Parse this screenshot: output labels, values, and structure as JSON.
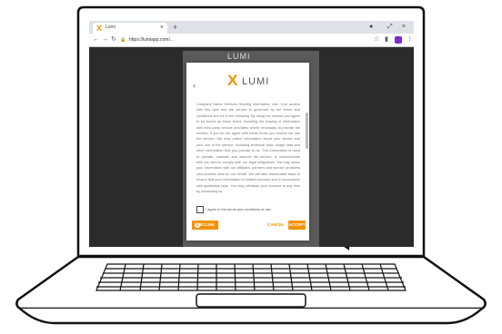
{
  "browser": {
    "tab_logo": "X",
    "tab_title": "Lumi",
    "tab_close": "×",
    "new_tab": "+",
    "window_controls": [
      "●",
      "⤢",
      "×"
    ],
    "url": "https://lumiapp.com/...",
    "nav_icons": [
      "back-icon",
      "forward-icon",
      "reload-icon"
    ]
  },
  "background_page": {
    "logo": "LUMI"
  },
  "modal": {
    "logo_mark": "X",
    "logo_text": "LUMI",
    "back_label": "‹",
    "terms_text": "Company Name Services Sharing Information Use. Your access with this web and the service is governed by the terms and conditions set out in the following. By using the service you agree to be bound by these terms, including the sharing of information with third party service providers where necessary to provide the service. If you do not agree with these terms you should not use the service. We may collect information about your device and your use of the service, including technical data, usage data and other information that you provide to us. This information is used to operate, maintain and improve the service, to communicate with you and to comply with our legal obligations. We may share your information with our affiliates, partners and service providers who process data on our behalf. We will take reasonable steps to ensure that your information is treated securely and in accordance with applicable laws. You may withdraw your consent at any time by contacting us.",
    "consent_label": "I agree to the terms and conditions of use.",
    "decline_label": "DECLINE",
    "decline_icon": "$",
    "cancel_label": "CANCEL",
    "accept_label": "ACCEPT"
  },
  "colors": {
    "accent": "#f39200",
    "annotation": "#e00000",
    "screen_bg": "#2b2b2b"
  }
}
